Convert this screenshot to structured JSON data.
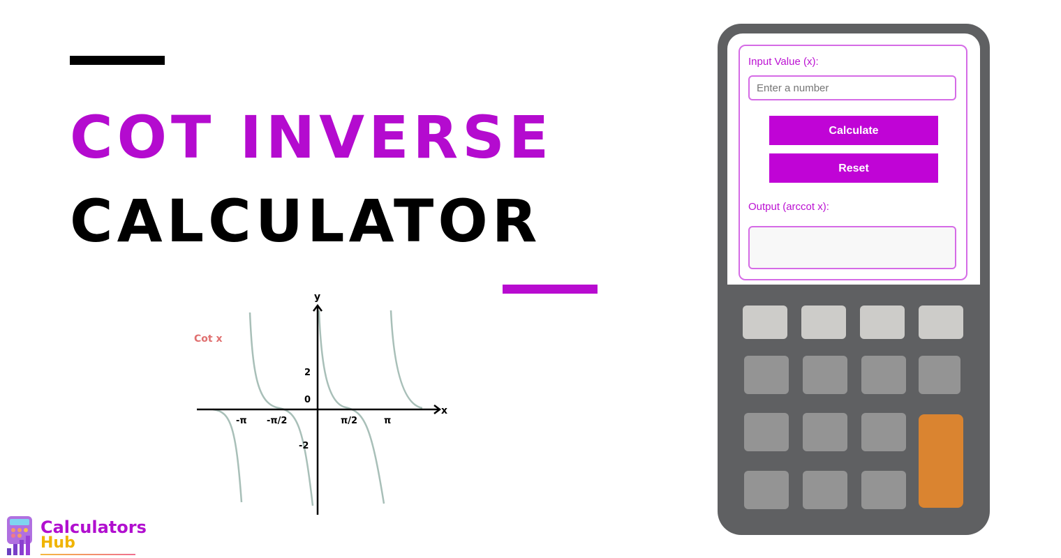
{
  "hero": {
    "title_line1": "COT INVERSE",
    "title_line2": "CALCULATOR",
    "accent_color": "#b40bcf"
  },
  "graph": {
    "function_label": "Cot x",
    "x_axis_label": "x",
    "y_axis_label": "y",
    "x_ticks": [
      "-π",
      "-π/2",
      "π/2",
      "π"
    ],
    "y_ticks": [
      "2",
      "0",
      "-2"
    ]
  },
  "logo": {
    "line1": "Calculators",
    "line2": "Hub"
  },
  "calculator": {
    "input_label": "Input Value (x):",
    "input_value": "",
    "input_placeholder": "Enter a number",
    "calculate_label": "Calculate",
    "reset_label": "Reset",
    "output_label": "Output (arccot x):",
    "output_value": ""
  }
}
